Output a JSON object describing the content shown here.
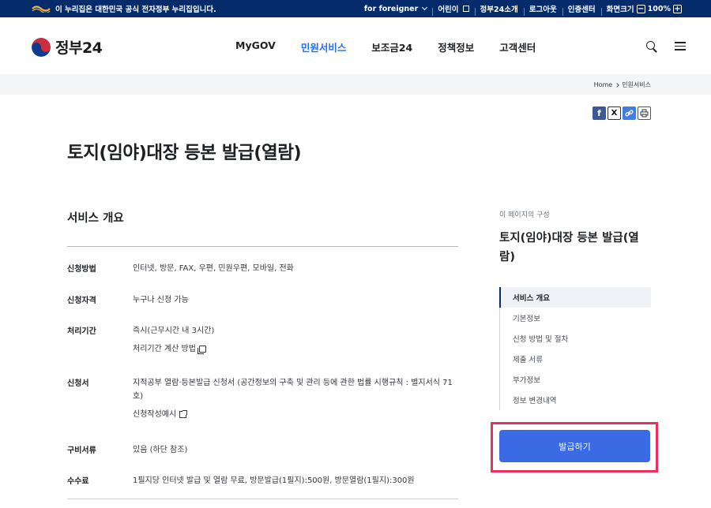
{
  "gov_banner": {
    "notice": "이 누리집은 대한민국 공식 전자정부 누리집입니다.",
    "links": [
      "for foreigner",
      "어린이",
      "정부24소개",
      "로그아웃",
      "인증센터"
    ],
    "zoom_label": "화면크기",
    "zoom_value": "100%",
    "zoom_minus": "−",
    "zoom_plus": "+"
  },
  "header": {
    "logo_text": "정부24",
    "nav": [
      "MyGOV",
      "민원서비스",
      "보조금24",
      "정책정보",
      "고객센터"
    ],
    "active_nav": "민원서비스"
  },
  "breadcrumb": {
    "home": "Home",
    "current": "민원서비스"
  },
  "share": {
    "facebook": "f",
    "x": "X",
    "link": "🔗",
    "print": "⎙"
  },
  "page_title": "토지(임야)대장 등본 발급(열람)",
  "overview": {
    "title": "서비스 개요",
    "rows": [
      {
        "key": "신청방법",
        "value": "인터넷, 방문, FAX, 우편, 민원우편, 모바일, 전화"
      },
      {
        "key": "신청자격",
        "value": "누구나 신청 가능"
      },
      {
        "key": "처리기간",
        "value": "즉시(근무시간 내 3시간)",
        "sub": "처리기간 계산 방법"
      },
      {
        "key": "신청서",
        "value": "지적공부 열람·등본발급 신청서 (공간정보의 구축 및 관리 등에 관한 법률 시행규칙 : 별지서식 71호)",
        "sub": "신청작성예시"
      },
      {
        "key": "구비서류",
        "value": "있음 (하단 참조)"
      },
      {
        "key": "수수료",
        "value": "1필지당 인터넷 발급 및 열람 무료, 방문발급(1필지):500원, 방문열람(1필지):300원"
      }
    ]
  },
  "toc": {
    "caption": "이 페이지의 구성",
    "title": "토지(임야)대장 등본 발급(열람)",
    "items": [
      "서비스 개요",
      "기본정보",
      "신청 방법 및 절차",
      "제출 서류",
      "부가정보",
      "정보 변경내역"
    ],
    "apply_button": "발급하기"
  },
  "colors": {
    "gov_bar": "#052b6b",
    "accent": "#256ef4",
    "apply_button": "#3a6be5",
    "highlight_border": "#e8305a"
  }
}
